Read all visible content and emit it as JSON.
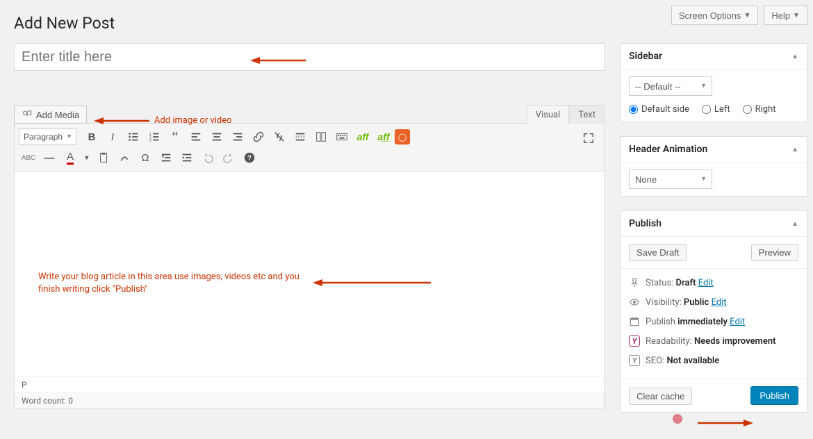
{
  "top": {
    "screen_options": "Screen Options",
    "help": "Help"
  },
  "page_title": "Add New Post",
  "title_placeholder": "Enter title here",
  "add_media": "Add Media",
  "tabs": {
    "visual": "Visual",
    "text": "Text"
  },
  "format_select": "Paragraph",
  "status_path": "P",
  "word_count_label": "Word count: ",
  "word_count_value": "0",
  "annotations": {
    "media": "Add image or video",
    "content": "Write your blog article in this area use images, videos etc and you finish writing click \"Publish\""
  },
  "sidebar_box": {
    "title": "Sidebar",
    "select": "-- Default --",
    "options": {
      "default": "Default side",
      "left": "Left",
      "right": "Right"
    }
  },
  "header_anim": {
    "title": "Header Animation",
    "select": "None"
  },
  "publish": {
    "title": "Publish",
    "save_draft": "Save Draft",
    "preview": "Preview",
    "status_label": "Status: ",
    "status_value": "Draft",
    "edit": "Edit",
    "visibility_label": "Visibility: ",
    "visibility_value": "Public",
    "schedule_label": "Publish ",
    "schedule_value": "immediately",
    "readability_label": "Readability: ",
    "readability_value": "Needs improvement",
    "seo_label": "SEO: ",
    "seo_value": "Not available",
    "clear_cache": "Clear cache",
    "publish_btn": "Publish"
  }
}
